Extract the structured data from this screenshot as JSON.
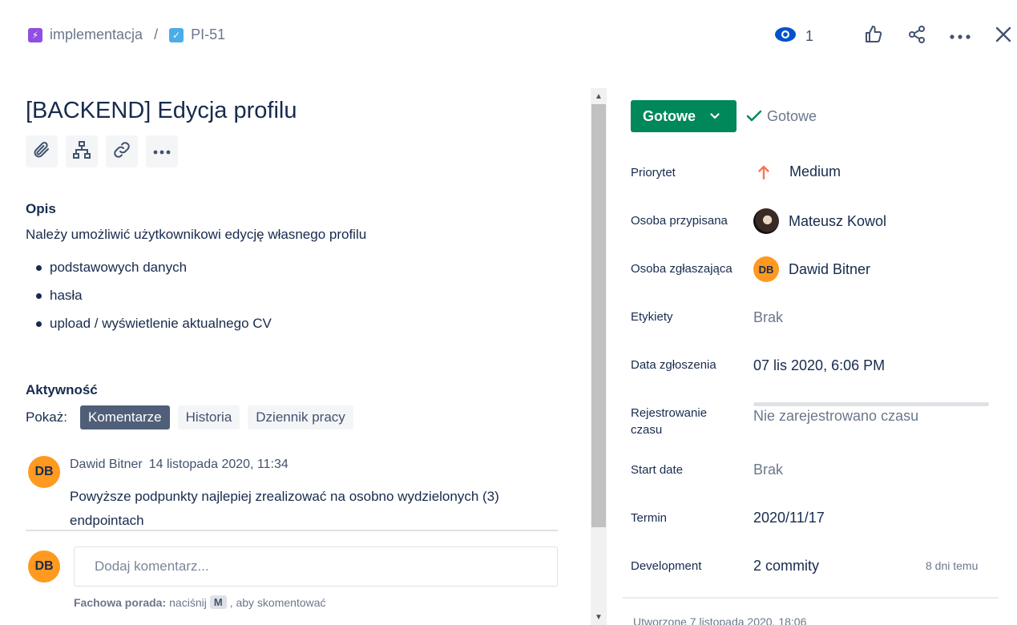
{
  "breadcrumb": {
    "epic": "implementacja",
    "separator": "/",
    "issue_key": "PI-51"
  },
  "header": {
    "watch_count": "1"
  },
  "issue": {
    "title": "[BACKEND] Edycja profilu"
  },
  "description": {
    "heading": "Opis",
    "text": "Należy umożliwić użytkownikowi edycję własnego profilu",
    "items": [
      "podstawowych danych",
      "hasła",
      "upload / wyświetlenie aktualnego CV"
    ]
  },
  "activity": {
    "heading": "Aktywność",
    "show_label": "Pokaż:",
    "tabs": [
      "Komentarze",
      "Historia",
      "Dziennik pracy"
    ],
    "comments": [
      {
        "initials": "DB",
        "author": "Dawid Bitner",
        "time": "14 listopada 2020, 11:34",
        "body": "Powyższe podpunkty najlepiej zrealizować na osobno wydzielonych (3) endpointach"
      }
    ],
    "new_comment": {
      "initials": "DB",
      "placeholder": "Dodaj komentarz...",
      "tip_bold": "Fachowa porada:",
      "tip_pre": "naciśnij",
      "tip_key": "M",
      "tip_post": ", aby skomentować"
    }
  },
  "sidebar": {
    "status_label": "Gotowe",
    "resolution": "Gotowe",
    "fields": {
      "priority": {
        "label": "Priorytet",
        "value": "Medium"
      },
      "assignee": {
        "label": "Osoba przypisana",
        "value": "Mateusz Kowol"
      },
      "reporter": {
        "label": "Osoba zgłaszająca",
        "value": "Dawid Bitner",
        "initials": "DB"
      },
      "labels": {
        "label": "Etykiety",
        "value": "Brak"
      },
      "created_date": {
        "label": "Data zgłoszenia",
        "value": "07 lis 2020, 6:06 PM"
      },
      "time_tracking": {
        "label": "Rejestrowanie czasu",
        "value": "Nie zarejestrowano czasu"
      },
      "start_date": {
        "label": "Start date",
        "value": "Brak"
      },
      "due_date": {
        "label": "Termin",
        "value": "2020/11/17"
      },
      "development": {
        "label": "Development",
        "value": "2 commity",
        "time": "8 dni temu"
      }
    },
    "created_footer": "Utworzone 7 listopada 2020, 18:06"
  },
  "colors": {
    "status_green": "#00875a",
    "priority_orange": "#ff7452",
    "watch_blue": "#0052cc",
    "avatar_orange": "#ff991f"
  }
}
